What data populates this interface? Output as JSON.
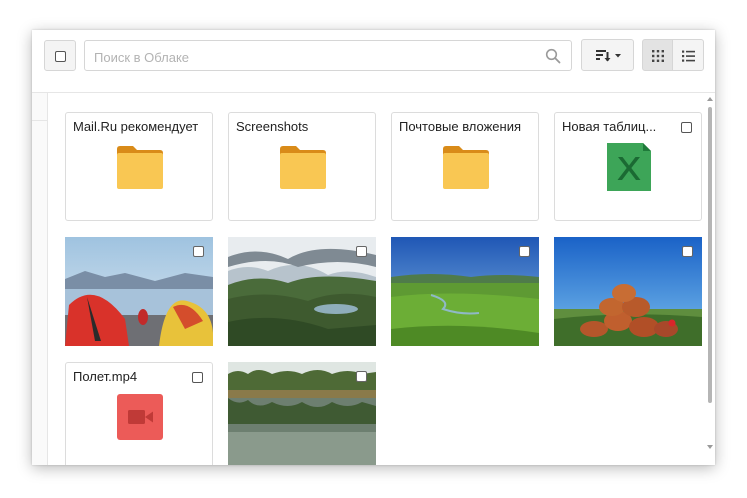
{
  "toolbar": {
    "search_placeholder": "Поиск в Облаке",
    "icons": {
      "select_all": "checkbox-icon",
      "search": "search-icon",
      "sort": "sort-icon",
      "grid": "grid-view-icon",
      "list": "list-view-icon"
    },
    "active_view": "grid"
  },
  "items": [
    {
      "name": "Mail.Ru рекомендует",
      "type": "folder",
      "icon": "folder-icon"
    },
    {
      "name": "Screenshots",
      "type": "folder",
      "icon": "folder-icon"
    },
    {
      "name": "Почтовые вложения",
      "type": "folder",
      "icon": "folder-icon"
    },
    {
      "name": "Новая таблиц...",
      "type": "spreadsheet",
      "icon": "excel-icon"
    },
    {
      "type": "photo",
      "subject": "tents-by-lake"
    },
    {
      "type": "photo",
      "subject": "mountain-valley"
    },
    {
      "type": "photo",
      "subject": "green-steppe"
    },
    {
      "type": "photo",
      "subject": "red-rocks"
    },
    {
      "name": "Полет.mp4",
      "type": "video",
      "icon": "video-icon"
    },
    {
      "type": "photo",
      "subject": "river-reflection"
    }
  ],
  "colors": {
    "folder": "#f9c753",
    "folder_tab": "#d98b19",
    "excel": "#3da558",
    "video": "#ec5b58",
    "selected_view_bg": "#e3e3e3"
  }
}
